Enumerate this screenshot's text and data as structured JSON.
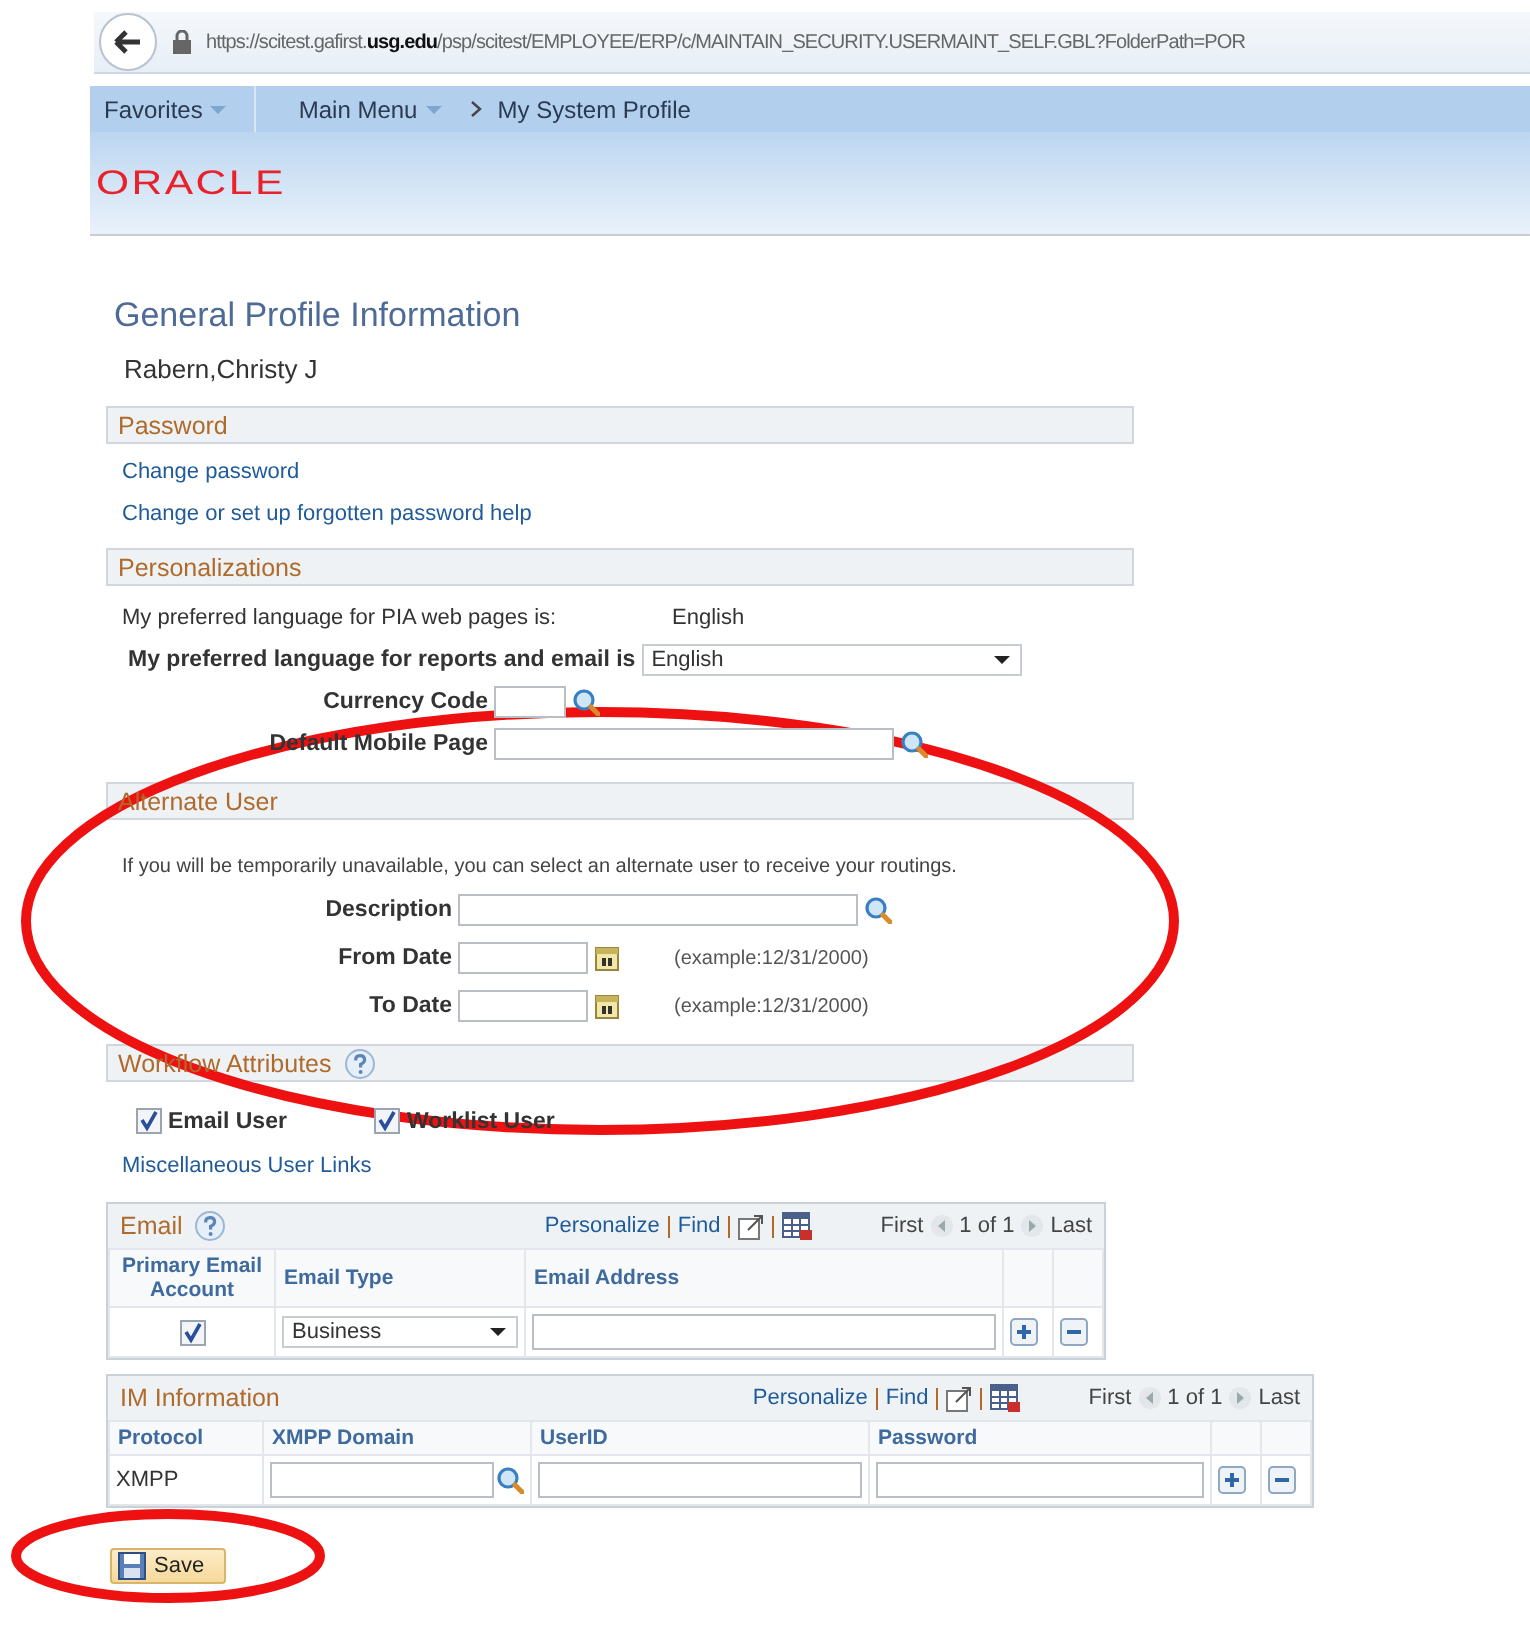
{
  "browser": {
    "url": "https://scitest.gafirst.**usg.edu**/psp/scitest/EMPLOYEE/ERP/c/MAINTAIN_SECURITY.USERMAINT_SELF.GBL?FolderPath=POR"
  },
  "nav": [
    {
      "label": "Favorites",
      "kind": "menu"
    },
    {
      "label": "Main Menu",
      "kind": "menu"
    },
    {
      "label": "My System Profile",
      "kind": "crumb"
    }
  ],
  "logo": "ORACLE",
  "title": "General Profile Information",
  "user_name": "Rabern,Christy J",
  "password": {
    "header": "Password",
    "links": [
      "Change password",
      "Change or set up forgotten password help"
    ]
  },
  "personalizations": {
    "header": "Personalizations",
    "pia_label": "My preferred language for PIA web pages is:",
    "pia_value": "English",
    "report_label": "My preferred language for reports and email is",
    "report_value": "English",
    "currency_label": "Currency Code",
    "mobile_label": "Default Mobile Page"
  },
  "alternate_user": {
    "header": "Alternate User",
    "circled": true,
    "note": "If you will be temporarily unavailable, you can select an alternate user to receive your routings.",
    "fields": [
      {
        "label": "Description",
        "kind": "lookup"
      },
      {
        "label": "From Date",
        "kind": "date",
        "hint": "(example:12/31/2000)"
      },
      {
        "label": "To Date",
        "kind": "date",
        "hint": "(example:12/31/2000)"
      }
    ]
  },
  "workflow": {
    "header": "Workflow Attributes",
    "checkboxes": [
      {
        "label": "Email User",
        "checked": true
      },
      {
        "label": "Worklist User",
        "checked": true
      }
    ],
    "link": "Miscellaneous User Links"
  },
  "grids": [
    {
      "title": "Email",
      "help": true,
      "personalize": "Personalize",
      "find": "Find",
      "first": "First",
      "count": "1 of 1",
      "last": "Last",
      "columns": [
        "Primary Email Account",
        "Email Type",
        "Email Address"
      ],
      "rows": [
        [
          {
            "kind": "checkbox",
            "checked": true
          },
          {
            "kind": "select",
            "value": "Business"
          },
          {
            "kind": "input"
          }
        ]
      ]
    },
    {
      "title": "IM Information",
      "help": false,
      "personalize": "Personalize",
      "find": "Find",
      "first": "First",
      "count": "1 of 1",
      "last": "Last",
      "columns": [
        "Protocol",
        "XMPP Domain",
        "UserID",
        "Password"
      ],
      "rows": [
        [
          {
            "kind": "text",
            "value": "XMPP"
          },
          {
            "kind": "lookup"
          },
          {
            "kind": "input"
          },
          {
            "kind": "input"
          }
        ]
      ]
    }
  ],
  "save": {
    "label": "Save",
    "circled": true
  }
}
